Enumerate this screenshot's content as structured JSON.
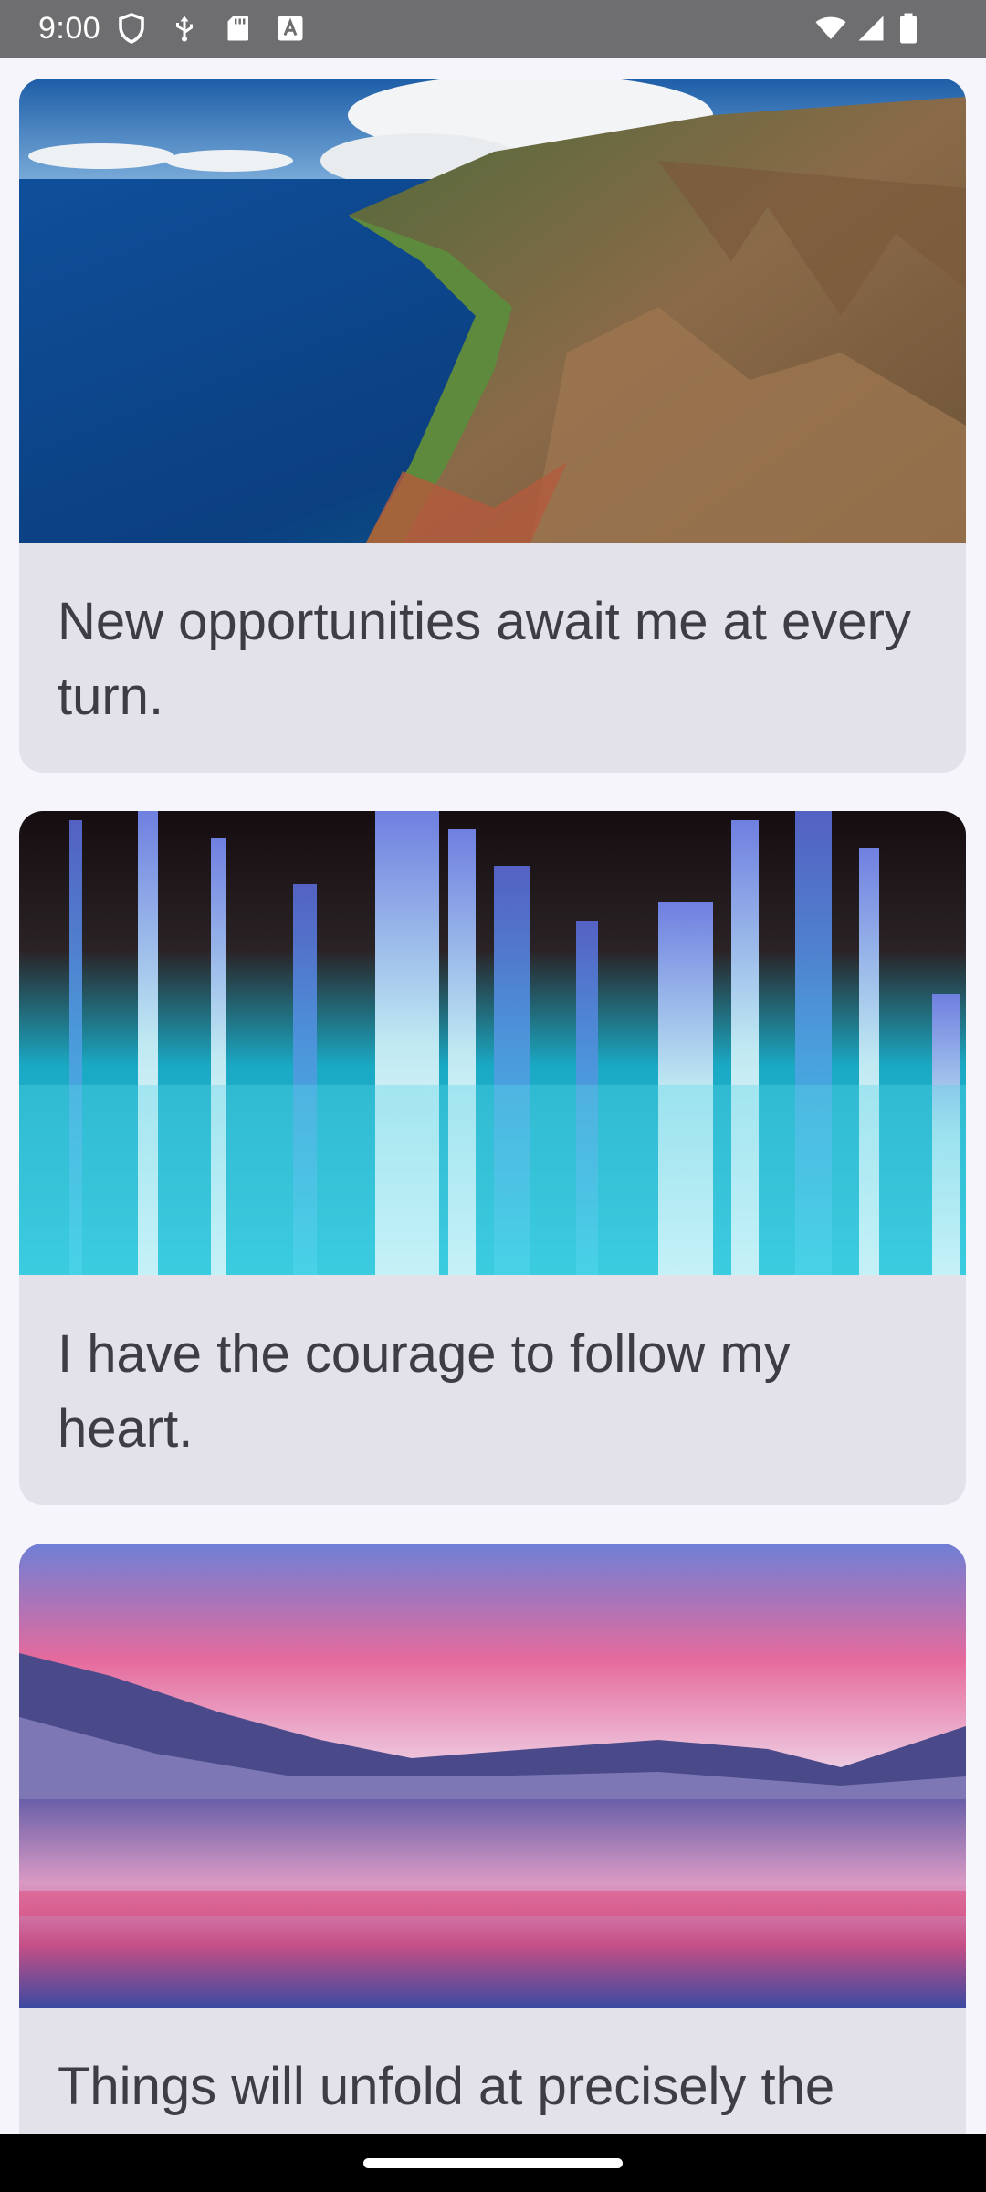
{
  "status_bar": {
    "time": "9:00",
    "icons_left": [
      "shield-icon",
      "usb-debug-icon",
      "sd-card-icon",
      "autofill-a-icon"
    ],
    "icons_right": [
      "wifi-icon",
      "cellular-signal-icon",
      "battery-icon"
    ]
  },
  "cards": [
    {
      "text": "New opportunities await me at every turn.",
      "image": "coastal-cliffs-image"
    },
    {
      "text": "I have the courage to follow my heart.",
      "image": "blue-light-streaks-image"
    },
    {
      "text": "Things will unfold at precisely the",
      "image": "pink-sky-lake-image"
    }
  ],
  "colors": {
    "background": "#f6f5fb",
    "card_background": "#e3e2ea",
    "card_text": "#3e3d45",
    "status_bar": "#6e6e70",
    "nav_bar": "#000000"
  }
}
